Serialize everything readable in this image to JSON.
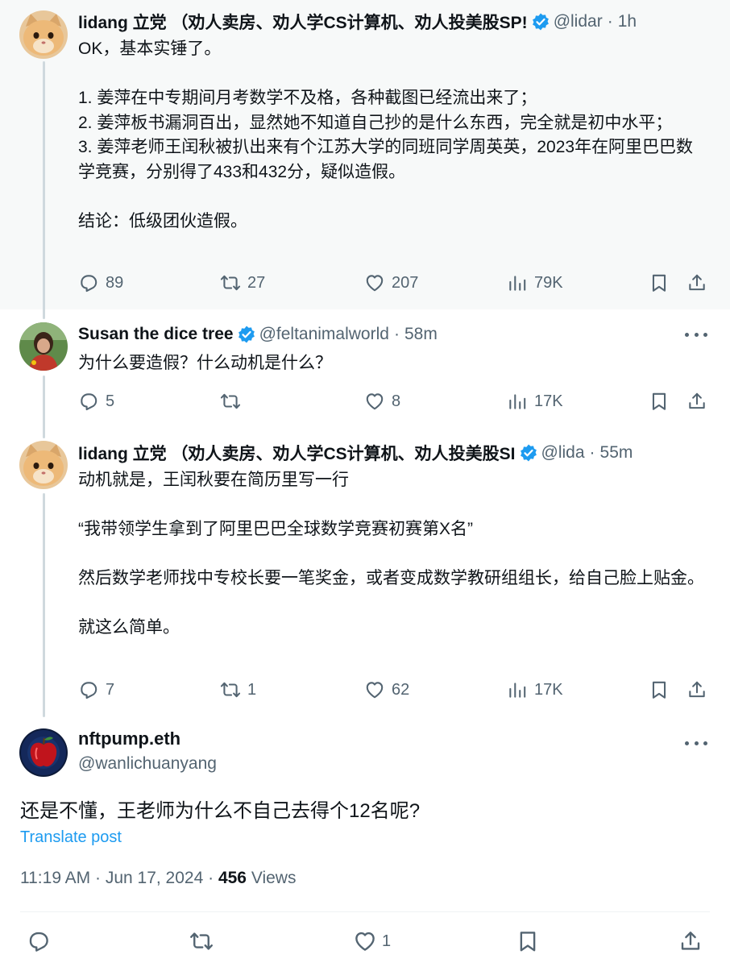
{
  "colors": {
    "accent": "#1d9bf0",
    "secondary_text": "#536471",
    "highlight_bg": "#f7f9f9"
  },
  "tweets": [
    {
      "name": "lidang 立党 （劝人卖房、劝人学CS计算机、劝人投美股SP!",
      "handle": "@lidar",
      "time": "1h",
      "body": "OK，基本实锤了。\n\n1. 姜萍在中专期间月考数学不及格，各种截图已经流出来了；\n2. 姜萍板书漏洞百出，显然她不知道自己抄的是什么东西，完全就是初中水平；\n3. 姜萍老师王闰秋被扒出来有个江苏大学的同班同学周英英，2023年在阿里巴巴数学竞赛，分别得了433和432分，疑似造假。\n\n结论：低级团伙造假。",
      "replies": "89",
      "reposts": "27",
      "likes": "207",
      "views": "79K"
    },
    {
      "name": "Susan the dice tree",
      "handle": "@feltanimalworld",
      "time": "58m",
      "body": "为什么要造假？什么动机是什么？",
      "replies": "5",
      "reposts": "",
      "likes": "8",
      "views": "17K"
    },
    {
      "name": "lidang 立党 （劝人卖房、劝人学CS计算机、劝人投美股SI",
      "handle": "@lida",
      "time": "55m",
      "body": "动机就是，王闰秋要在简历里写一行\n\n“我带领学生拿到了阿里巴巴全球数学竞赛初赛第X名”\n\n然后数学老师找中专校长要一笔奖金，或者变成数学教研组组长，给自己脸上贴金。\n\n就这么简单。",
      "replies": "7",
      "reposts": "1",
      "likes": "62",
      "views": "17K"
    }
  ],
  "main_tweet": {
    "name": "nftpump.eth",
    "handle": "@wanlichuanyang",
    "body": "还是不懂，王老师为什么不自己去得个12名呢?",
    "translate": "Translate post",
    "time": "11:19 AM · Jun 17, 2024 · ",
    "views_count": "456",
    "views_label": " Views",
    "likes": "1"
  },
  "icons": [
    "verified-badge-icon",
    "more-icon",
    "reply-icon",
    "repost-icon",
    "like-icon",
    "views-icon",
    "bookmark-icon",
    "share-icon"
  ]
}
